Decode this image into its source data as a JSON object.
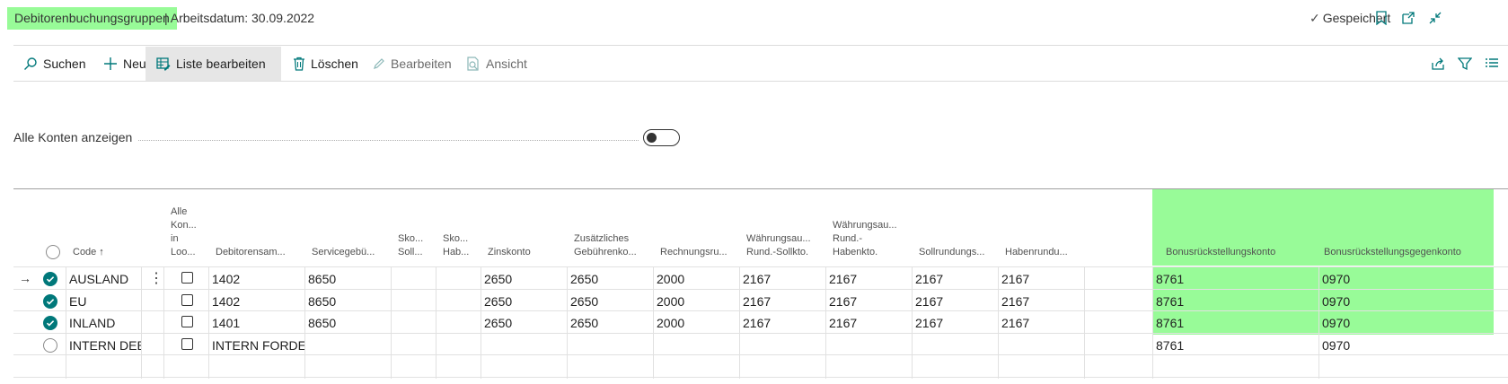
{
  "header": {
    "title": "Debitorenbuchungsgruppen",
    "subtitle": "| Arbeitsdatum: 30.09.2022",
    "saved_label": "Gespeichert"
  },
  "actions": {
    "search": "Suchen",
    "new": "Neu",
    "edit_list": "Liste bearbeiten",
    "delete": "Löschen",
    "edit": "Bearbeiten",
    "view": "Ansicht"
  },
  "filter": {
    "label": "Alle Konten anzeigen",
    "toggle_on": false
  },
  "colors": {
    "highlight": "#98fb98",
    "accent": "#00787a"
  },
  "table": {
    "columns": {
      "code": "Code",
      "sort_icon": "↑",
      "all_accounts": "Alle Kon... in Loo...",
      "receivables": "Debitorensam...",
      "service": "Servicegebü...",
      "disc_debit": "Sko... Soll...",
      "disc_credit": "Sko... Hab...",
      "interest": "Zinskonto",
      "additional_fee": "Zusätzliches Gebührenko...",
      "invoice_rounding": "Rechnungsru...",
      "curr_debit": "Währungsau... Rund.-Sollkto.",
      "curr_credit": "Währungsau... Rund.- Habenkto.",
      "debit_rounding": "Sollrundungs...",
      "credit_rounding": "Habenrundu...",
      "bonus": "Bonusrückstellungskonto",
      "bonus_contra": "Bonusrückstellungsgegenkonto"
    },
    "header_lines": {
      "all_accounts": [
        "Alle",
        "Kon...",
        "in",
        "Loo..."
      ],
      "disc_debit": [
        "Sko...",
        "Soll..."
      ],
      "disc_credit": [
        "Sko...",
        "Hab..."
      ],
      "additional_fee": [
        "Zusätzliches",
        "Gebührenko..."
      ],
      "curr_debit": [
        "Währungsau...",
        "Rund.-Sollkto."
      ],
      "curr_credit": [
        "Währungsau...",
        "Rund.-",
        "Habenkto."
      ]
    },
    "rows": [
      {
        "code": "AUSLAND",
        "selected": true,
        "current": true,
        "receivables": "1402",
        "service": "8650",
        "disc_debit": "",
        "disc_credit": "",
        "interest": "2650",
        "additional_fee": "2650",
        "invoice_rounding": "2000",
        "curr_debit": "2167",
        "curr_credit": "2167",
        "debit_rounding": "2167",
        "credit_rounding": "2167",
        "bonus": "8761",
        "bonus_contra": "0970"
      },
      {
        "code": "EU",
        "selected": true,
        "current": false,
        "receivables": "1402",
        "service": "8650",
        "disc_debit": "",
        "disc_credit": "",
        "interest": "2650",
        "additional_fee": "2650",
        "invoice_rounding": "2000",
        "curr_debit": "2167",
        "curr_credit": "2167",
        "debit_rounding": "2167",
        "credit_rounding": "2167",
        "bonus": "8761",
        "bonus_contra": "0970"
      },
      {
        "code": "INLAND",
        "selected": true,
        "current": false,
        "receivables": "1401",
        "service": "8650",
        "disc_debit": "",
        "disc_credit": "",
        "interest": "2650",
        "additional_fee": "2650",
        "invoice_rounding": "2000",
        "curr_debit": "2167",
        "curr_credit": "2167",
        "debit_rounding": "2167",
        "credit_rounding": "2167",
        "bonus": "8761",
        "bonus_contra": "0970"
      },
      {
        "code": "INTERN DEB",
        "selected": false,
        "current": false,
        "receivables": "INTERN FORDE...",
        "service": "",
        "disc_debit": "",
        "disc_credit": "",
        "interest": "",
        "additional_fee": "",
        "invoice_rounding": "",
        "curr_debit": "",
        "curr_credit": "",
        "debit_rounding": "",
        "credit_rounding": "",
        "bonus": "8761",
        "bonus_contra": "0970"
      }
    ]
  }
}
